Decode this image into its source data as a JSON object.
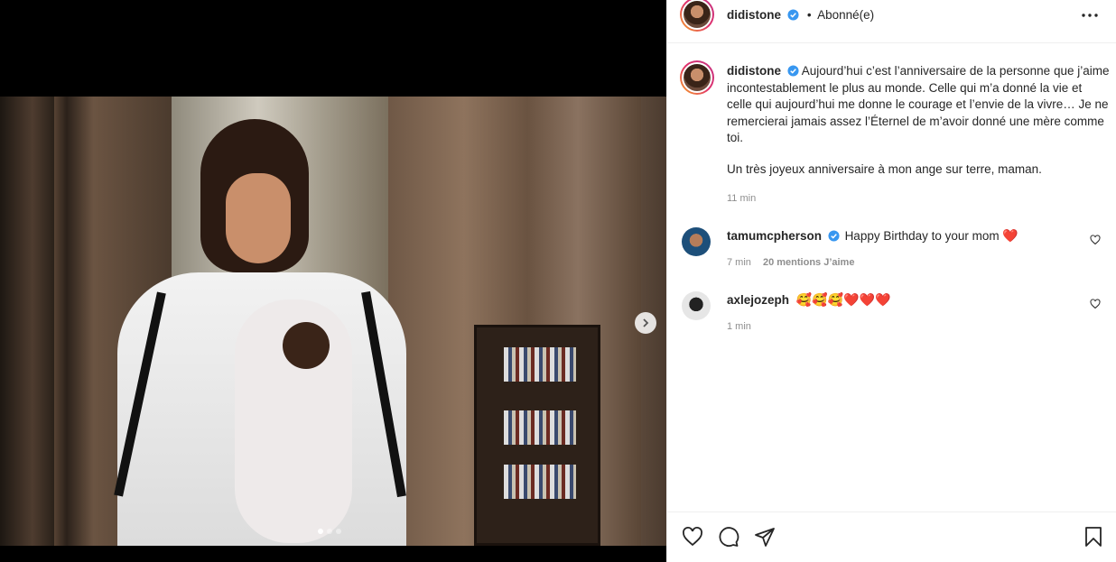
{
  "post": {
    "author": "didistone",
    "separator": "•",
    "follow_status": "Abonné(e)",
    "caption_lines": [
      "Aujourd’hui c’est l’anniversaire de la personne que j’aime incontestablement le plus au monde. Celle qui m’a donné la vie et celle qui aujourd’hui me donne le courage et l’envie de la vivre… Je ne remercierai jamais assez l’Éternel de m’avoir donné une mère comme toi.",
      "Un très joyeux anniversaire à mon ange sur terre, maman."
    ],
    "caption_time": "11 min"
  },
  "comments": [
    {
      "user": "tamumcpherson",
      "verified": true,
      "text": "Happy Birthday to your mom",
      "emoji": "❤️",
      "time": "7 min",
      "likes": "20 mentions J’aime"
    },
    {
      "user": "axlejozeph",
      "verified": false,
      "text": "",
      "emoji": "🥰🥰🥰❤️❤️❤️",
      "time": "1 min",
      "likes": ""
    }
  ],
  "carousel": {
    "count": 3,
    "active": 0
  },
  "icons": {
    "verified": "verified-badge-icon",
    "more": "more-options-icon",
    "next": "chevron-right-icon",
    "like": "heart-icon",
    "comment": "comment-icon",
    "share": "share-icon",
    "save": "bookmark-icon"
  },
  "colors": {
    "verified_blue": "#3897f0",
    "text": "#262626",
    "muted": "#8e8e8e",
    "heart_red": "#ed4956"
  }
}
